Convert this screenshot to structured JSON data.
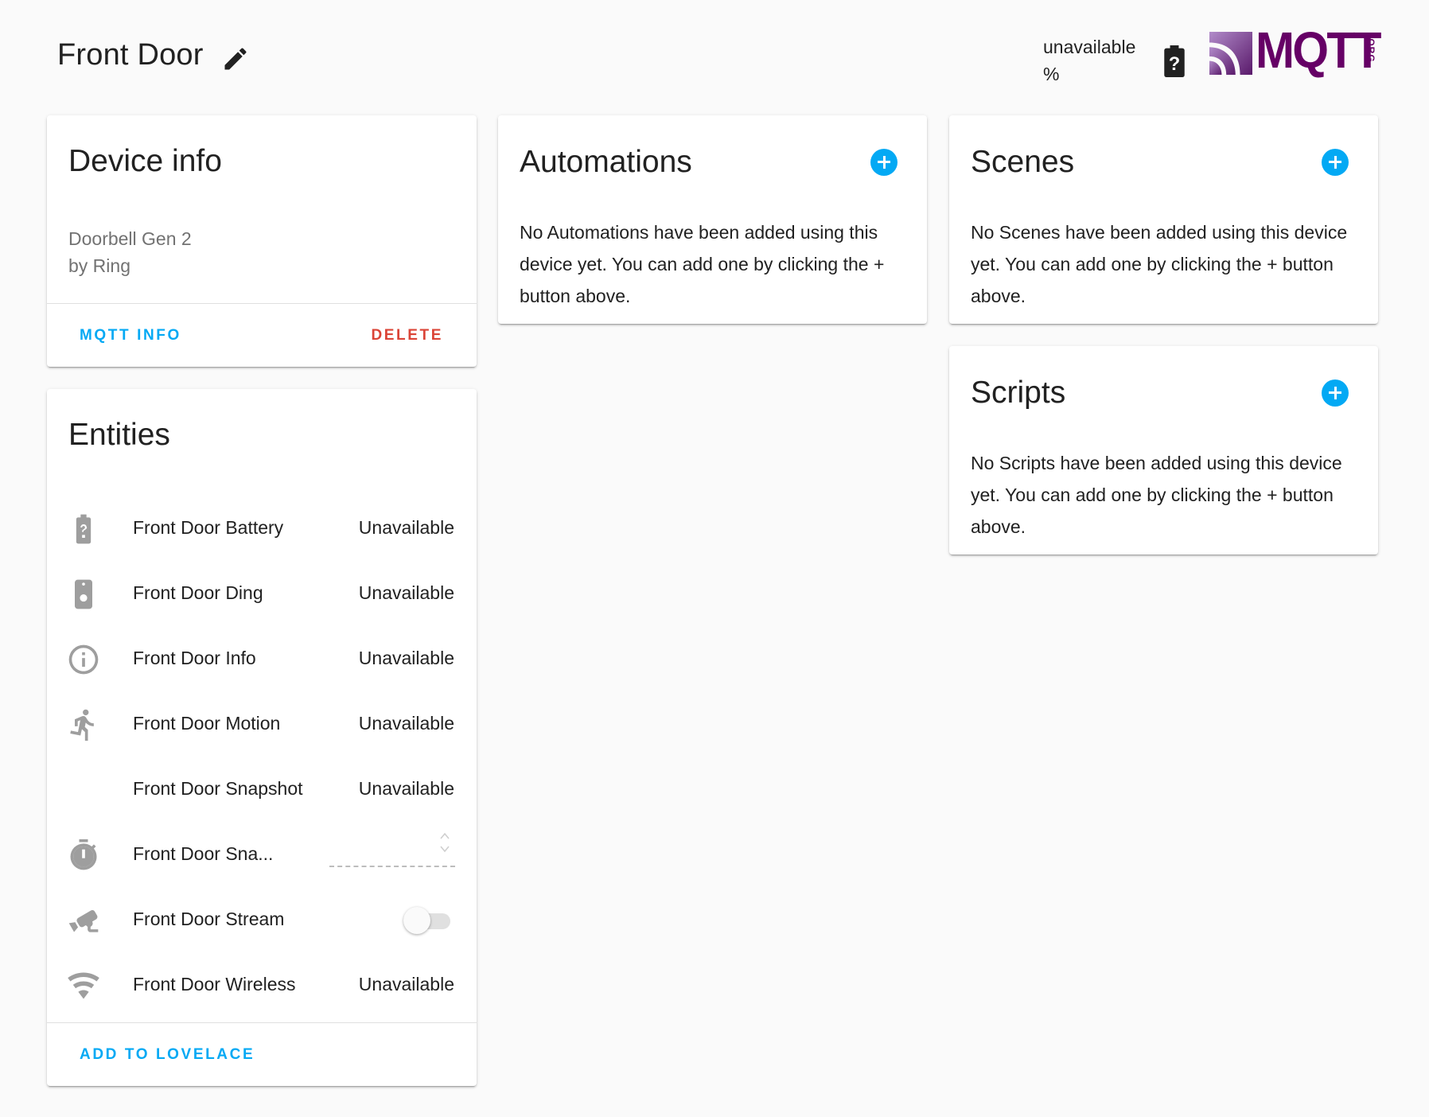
{
  "header": {
    "title": "Front Door",
    "battery_value": "unavailable",
    "battery_unit": "%",
    "logo_text": "MQTT",
    "logo_suffix": ".ORG"
  },
  "device_info": {
    "title": "Device info",
    "model": "Doorbell Gen 2",
    "manufacturer": "by Ring",
    "mqtt_info_label": "MQTT INFO",
    "delete_label": "DELETE"
  },
  "entities": {
    "title": "Entities",
    "items": [
      {
        "name": "Front Door Battery",
        "state": "Unavailable",
        "icon": "battery-unknown-icon"
      },
      {
        "name": "Front Door Ding",
        "state": "Unavailable",
        "icon": "doorbell-icon"
      },
      {
        "name": "Front Door Info",
        "state": "Unavailable",
        "icon": "info-icon"
      },
      {
        "name": "Front Door Motion",
        "state": "Unavailable",
        "icon": "run-icon"
      },
      {
        "name": "Front Door Snapshot",
        "state": "Unavailable",
        "icon": ""
      },
      {
        "name": "Front Door Sna...",
        "state": "",
        "icon": "timer-icon",
        "control": "number-input"
      },
      {
        "name": "Front Door Stream",
        "state": "",
        "icon": "cctv-icon",
        "control": "toggle",
        "on": false
      },
      {
        "name": "Front Door Wireless",
        "state": "Unavailable",
        "icon": "wifi-icon"
      }
    ],
    "add_to_lovelace_label": "ADD TO LOVELACE"
  },
  "automations": {
    "title": "Automations",
    "text": "No Automations have been added using this device yet. You can add one by clicking the + button above."
  },
  "scenes": {
    "title": "Scenes",
    "text": "No Scenes have been added using this device yet. You can add one by clicking the + button above."
  },
  "scripts": {
    "title": "Scripts",
    "text": "No Scripts have been added using this device yet. You can add one by clicking the + button above."
  },
  "colors": {
    "primary": "#03a9f4",
    "delete": "#db4437",
    "icon": "#9e9e9e",
    "background": "#fafafa",
    "logo": "#660066"
  }
}
